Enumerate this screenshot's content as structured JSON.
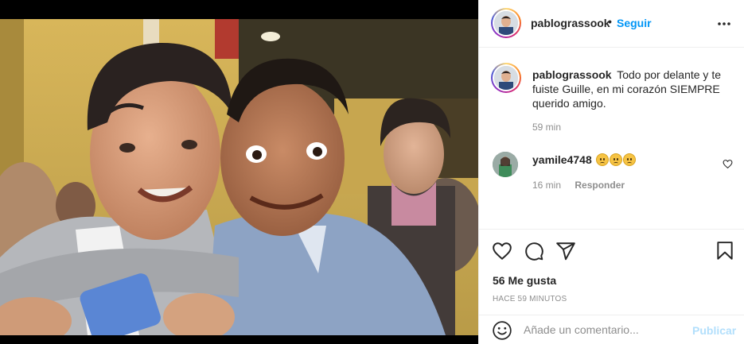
{
  "post": {
    "author": "pablograssook",
    "follow_label": "Seguir",
    "separator": "•",
    "caption": "Todo por delante y te fuiste Guille, en mi corazón SIEMPRE querido amigo.",
    "caption_time": "59 min"
  },
  "comments": [
    {
      "username": "yamile4748",
      "emoji_count": 3,
      "time": "16 min",
      "reply_label": "Responder"
    }
  ],
  "stats": {
    "likes": "56 Me gusta",
    "posted_ago": "HACE 59 MINUTOS"
  },
  "add_comment": {
    "placeholder": "Añade un comentario...",
    "publish_label": "Publicar"
  },
  "icons": {
    "more": "more-options-icon",
    "like": "heart-icon",
    "comment": "comment-icon",
    "share": "share-icon",
    "save": "bookmark-icon",
    "emoji": "smiley-icon"
  },
  "colors": {
    "accent": "#0095f6",
    "publish_disabled": "#b2dffc",
    "secondary_text": "#8e8e8e",
    "border": "#efefef"
  }
}
